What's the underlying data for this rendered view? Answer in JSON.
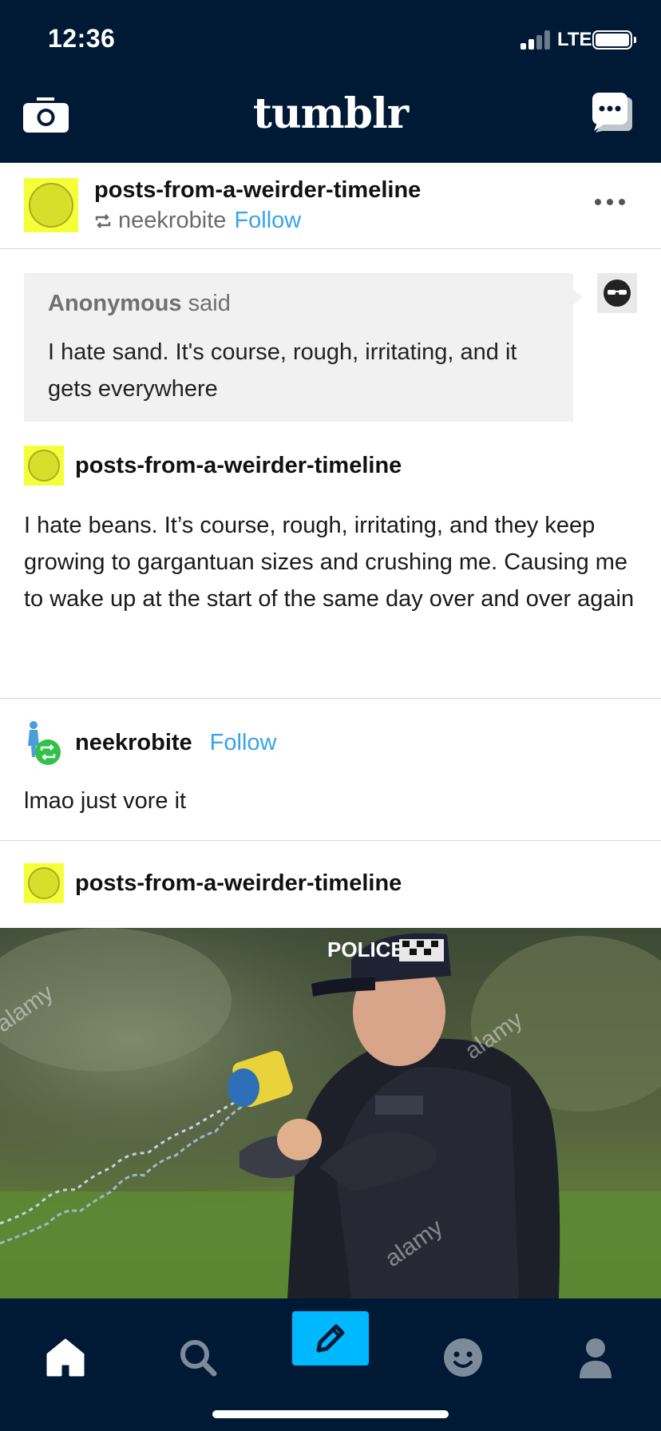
{
  "status_bar": {
    "time": "12:36",
    "network": "LTE"
  },
  "header": {
    "logo": "tumblr"
  },
  "post": {
    "blog_name": "posts-from-a-weirder-timeline",
    "reblogged_from": "neekrobite",
    "follow_label": "Follow"
  },
  "ask": {
    "asker": "Anonymous",
    "said": " said",
    "question": "I hate sand. It's course, rough, irritating, and it gets everywhere"
  },
  "trail": [
    {
      "blog_name": "posts-from-a-weirder-timeline",
      "text": "I hate beans. It’s course, rough, irritating, and they keep growing to gargantuan sizes and crushing me. Causing me to wake up at the start of the same day over and over again"
    },
    {
      "blog_name": "neekrobite",
      "follow_label": "Follow",
      "text": "lmao just vore it"
    },
    {
      "blog_name": "posts-from-a-weirder-timeline"
    }
  ],
  "photo": {
    "cap_text": "POLICE",
    "watermark": "alamy"
  },
  "tabbar": {
    "icons": [
      "home-icon",
      "search-icon",
      "compose-icon",
      "activity-icon",
      "account-icon"
    ],
    "accent": "#00b8ff"
  },
  "colors": {
    "nav_bg": "#001935",
    "link": "#36a5e8",
    "avatar_yellow": "#f4ff3a"
  }
}
